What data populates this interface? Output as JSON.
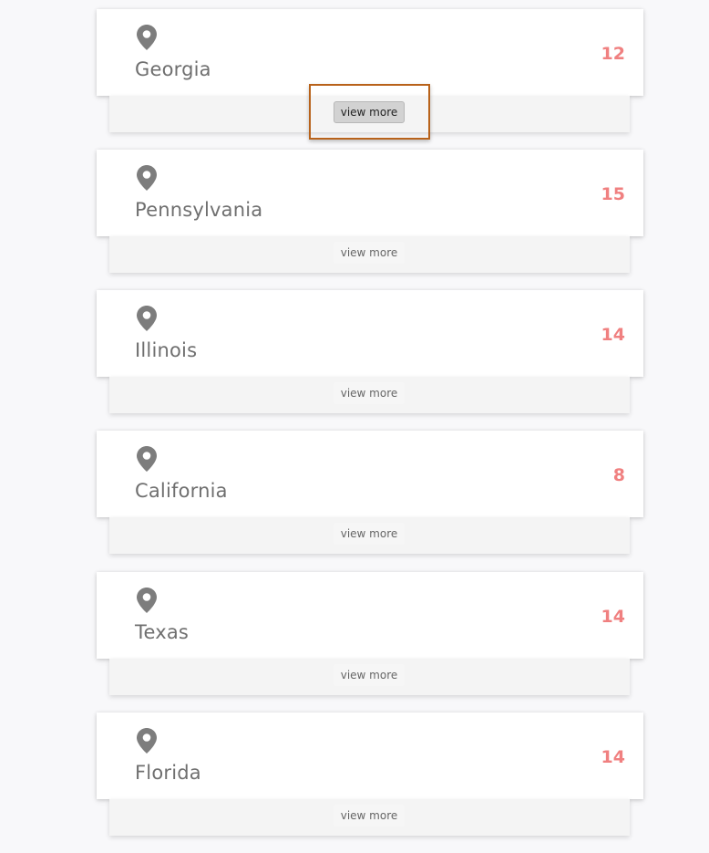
{
  "states": [
    {
      "name": "Georgia",
      "count": "12",
      "button_label": "view more"
    },
    {
      "name": "Pennsylvania",
      "count": "15",
      "button_label": "view more"
    },
    {
      "name": "Illinois",
      "count": "14",
      "button_label": "view more"
    },
    {
      "name": "California",
      "count": "8",
      "button_label": "view more"
    },
    {
      "name": "Texas",
      "count": "14",
      "button_label": "view more"
    },
    {
      "name": "Florida",
      "count": "14",
      "button_label": "view more"
    }
  ],
  "icons": {
    "location": "map-pin-icon"
  },
  "colors": {
    "count": "#f08080",
    "name": "#6f6f6f",
    "focus_outline": "#b8621a"
  },
  "focused_index": 0
}
